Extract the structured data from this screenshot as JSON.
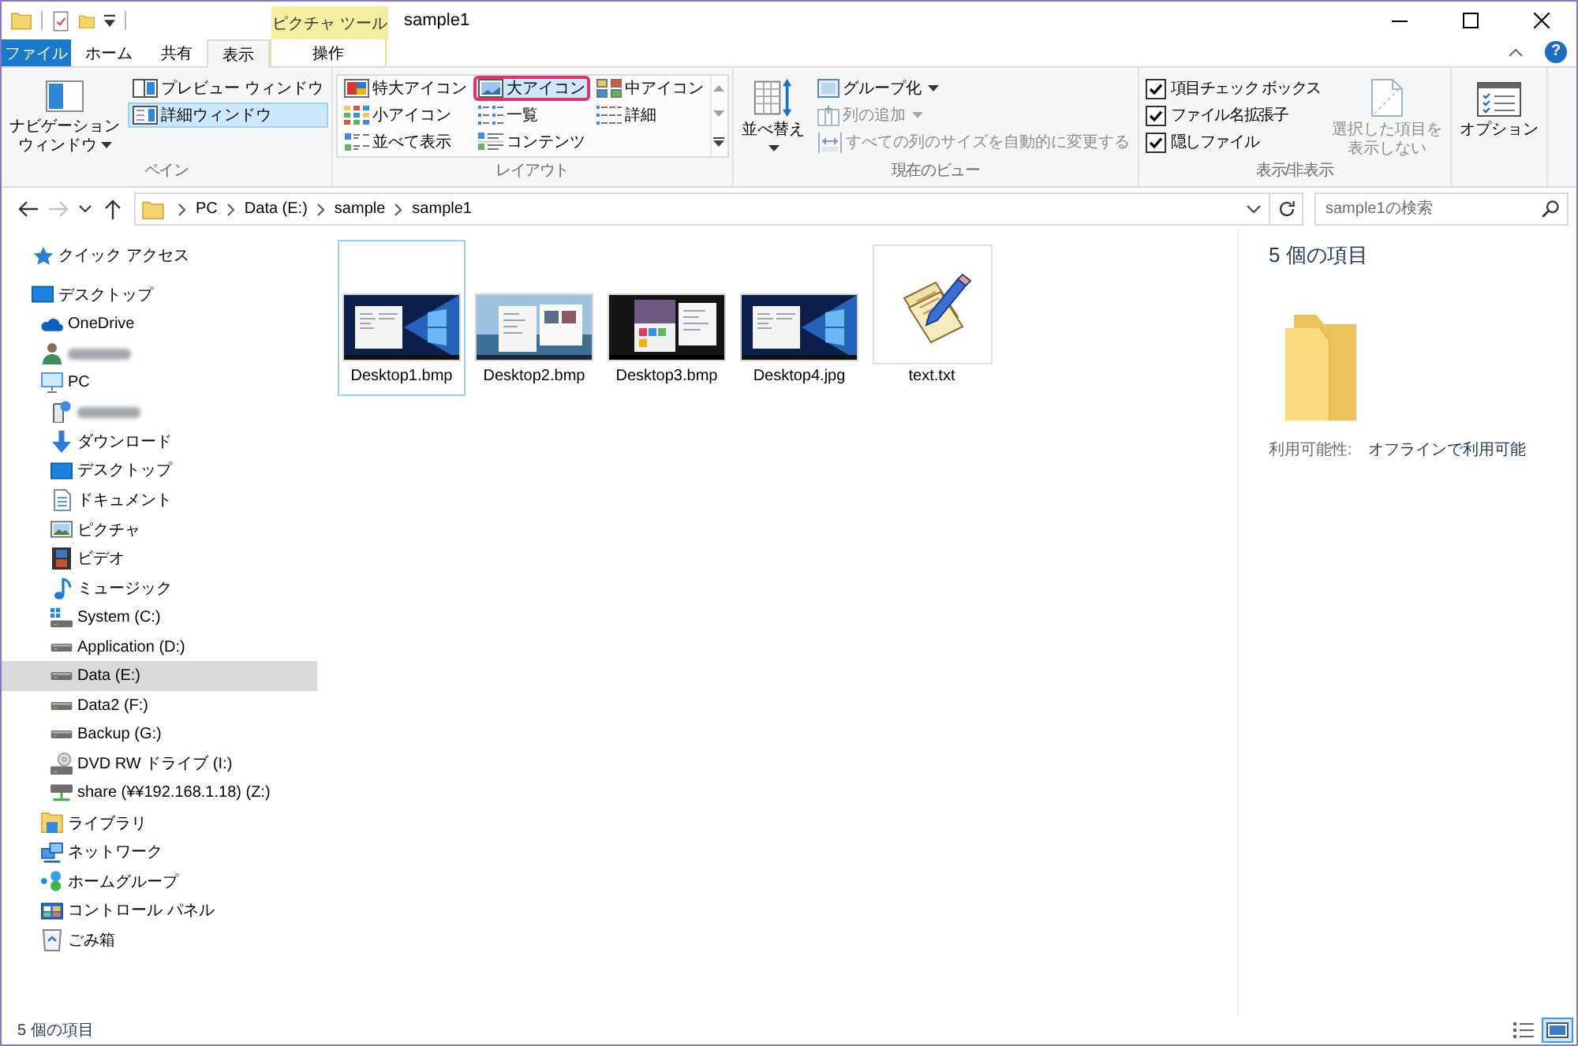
{
  "title_bar": {
    "context_tab_group": "ピクチャ ツール",
    "title": "sample1"
  },
  "ribbon_tabs": [
    {
      "label": "ファイル",
      "kind": "file",
      "selected": false
    },
    {
      "label": "ホーム",
      "kind": "normal",
      "selected": false
    },
    {
      "label": "共有",
      "kind": "normal",
      "selected": false
    },
    {
      "label": "表示",
      "kind": "normal",
      "selected": true
    },
    {
      "label": "操作",
      "kind": "context",
      "selected": false
    }
  ],
  "help_button": {
    "label": "?"
  },
  "pane_group": {
    "label": "ペイン",
    "navigation_button": {
      "label_lines": [
        "ナビゲーション",
        "ウィンドウ"
      ],
      "dropdown": true
    },
    "buttons": [
      {
        "label": "プレビュー ウィンドウ",
        "kind": "preview",
        "selected": false
      },
      {
        "label": "詳細ウィンドウ",
        "kind": "details",
        "selected": true
      }
    ]
  },
  "layout_group": {
    "label": "レイアウト",
    "options": [
      {
        "label": "特大アイコン",
        "kind": "extra-large",
        "selected": false,
        "highlighted": false
      },
      {
        "label": "大アイコン",
        "kind": "large",
        "selected": true,
        "highlighted": true
      },
      {
        "label": "中アイコン",
        "kind": "medium",
        "selected": false,
        "highlighted": false
      },
      {
        "label": "小アイコン",
        "kind": "small",
        "selected": false,
        "highlighted": false
      },
      {
        "label": "一覧",
        "kind": "list",
        "selected": false,
        "highlighted": false
      },
      {
        "label": "詳細",
        "kind": "details",
        "selected": false,
        "highlighted": false
      },
      {
        "label": "並べて表示",
        "kind": "tiles",
        "selected": false,
        "highlighted": false
      },
      {
        "label": "コンテンツ",
        "kind": "content",
        "selected": false,
        "highlighted": false
      }
    ]
  },
  "current_view_group": {
    "label": "現在のビュー",
    "sort_button": {
      "label": "並べ替え",
      "dropdown": true
    },
    "buttons": [
      {
        "label": "グループ化",
        "kind": "group-by",
        "dropdown": true,
        "disabled": false
      },
      {
        "label": "列の追加",
        "kind": "add-column",
        "dropdown": true,
        "disabled": true
      },
      {
        "label": "すべての列のサイズを自動的に変更する",
        "kind": "autosize",
        "dropdown": false,
        "disabled": true
      }
    ]
  },
  "show_hide_group": {
    "label": "表示/非表示",
    "checkboxes": [
      {
        "label": "項目チェック ボックス",
        "checked": true
      },
      {
        "label": "ファイル名拡張子",
        "checked": true
      },
      {
        "label": "隠しファイル",
        "checked": true
      }
    ],
    "hide_button": {
      "label_lines": [
        "選択した項目を",
        "表示しない"
      ],
      "disabled": true
    }
  },
  "options_group": {
    "options_button": {
      "label": "オプション"
    }
  },
  "address_bar": {
    "nav_buttons": [
      {
        "kind": "back",
        "disabled": false
      },
      {
        "kind": "forward",
        "disabled": true
      },
      {
        "kind": "recent",
        "disabled": false
      },
      {
        "kind": "up",
        "disabled": false
      }
    ],
    "path": [
      "PC",
      "Data (E:)",
      "sample",
      "sample1"
    ],
    "search": {
      "placeholder": "sample1の検索"
    }
  },
  "navigation_pane": {
    "items": [
      {
        "label": "クイック アクセス",
        "kind": "quick-access",
        "selected": false,
        "redacted": false
      },
      {
        "label": "デスクトップ",
        "kind": "desktop",
        "selected": false,
        "redacted": false,
        "children": [
          {
            "label": "OneDrive",
            "kind": "onedrive",
            "selected": false,
            "redacted": false
          },
          {
            "kind": "user",
            "selected": false,
            "redacted": true
          },
          {
            "label": "PC",
            "kind": "pc",
            "selected": false,
            "redacted": false,
            "children": [
              {
                "kind": "device",
                "selected": false,
                "redacted": true
              },
              {
                "label": "ダウンロード",
                "kind": "downloads",
                "selected": false,
                "redacted": false
              },
              {
                "label": "デスクトップ",
                "kind": "desktop",
                "selected": false,
                "redacted": false
              },
              {
                "label": "ドキュメント",
                "kind": "documents",
                "selected": false,
                "redacted": false
              },
              {
                "label": "ピクチャ",
                "kind": "pictures",
                "selected": false,
                "redacted": false
              },
              {
                "label": "ビデオ",
                "kind": "videos",
                "selected": false,
                "redacted": false
              },
              {
                "label": "ミュージック",
                "kind": "music",
                "selected": false,
                "redacted": false
              },
              {
                "label": "System (C:)",
                "kind": "system-drive",
                "selected": false,
                "redacted": false
              },
              {
                "label": "Application (D:)",
                "kind": "drive",
                "selected": false,
                "redacted": false
              },
              {
                "label": "Data (E:)",
                "kind": "drive",
                "selected": true,
                "redacted": false
              },
              {
                "label": "Data2 (F:)",
                "kind": "drive",
                "selected": false,
                "redacted": false
              },
              {
                "label": "Backup (G:)",
                "kind": "drive",
                "selected": false,
                "redacted": false
              },
              {
                "label": "DVD RW ドライブ (I:)",
                "kind": "dvd-drive",
                "selected": false,
                "redacted": false
              },
              {
                "label": "share (¥¥192.168.1.18) (Z:)",
                "kind": "network-drive",
                "selected": false,
                "redacted": false
              }
            ]
          },
          {
            "label": "ライブラリ",
            "kind": "libraries",
            "selected": false,
            "redacted": false
          },
          {
            "label": "ネットワーク",
            "kind": "network",
            "selected": false,
            "redacted": false
          },
          {
            "label": "ホームグループ",
            "kind": "homegroup",
            "selected": false,
            "redacted": false
          },
          {
            "label": "コントロール パネル",
            "kind": "control-panel",
            "selected": false,
            "redacted": false
          },
          {
            "label": "ごみ箱",
            "kind": "recycle-bin",
            "selected": false,
            "redacted": false
          }
        ]
      }
    ]
  },
  "files": [
    {
      "name": "Desktop1.bmp",
      "kind": "image",
      "selected": false,
      "focused": true
    },
    {
      "name": "Desktop2.bmp",
      "kind": "image",
      "selected": false,
      "focused": false
    },
    {
      "name": "Desktop3.bmp",
      "kind": "image",
      "selected": false,
      "focused": false
    },
    {
      "name": "Desktop4.jpg",
      "kind": "image",
      "selected": false,
      "focused": false
    },
    {
      "name": "text.txt",
      "kind": "text",
      "selected": false,
      "focused": false
    }
  ],
  "details_pane": {
    "title": "5 個の項目",
    "properties": [
      {
        "label": "利用可能性:",
        "value": "オフラインで利用可能"
      }
    ]
  },
  "status_bar": {
    "text": "5 個の項目",
    "view_buttons": [
      {
        "kind": "details",
        "selected": false
      },
      {
        "kind": "large-icons",
        "selected": true
      }
    ]
  }
}
